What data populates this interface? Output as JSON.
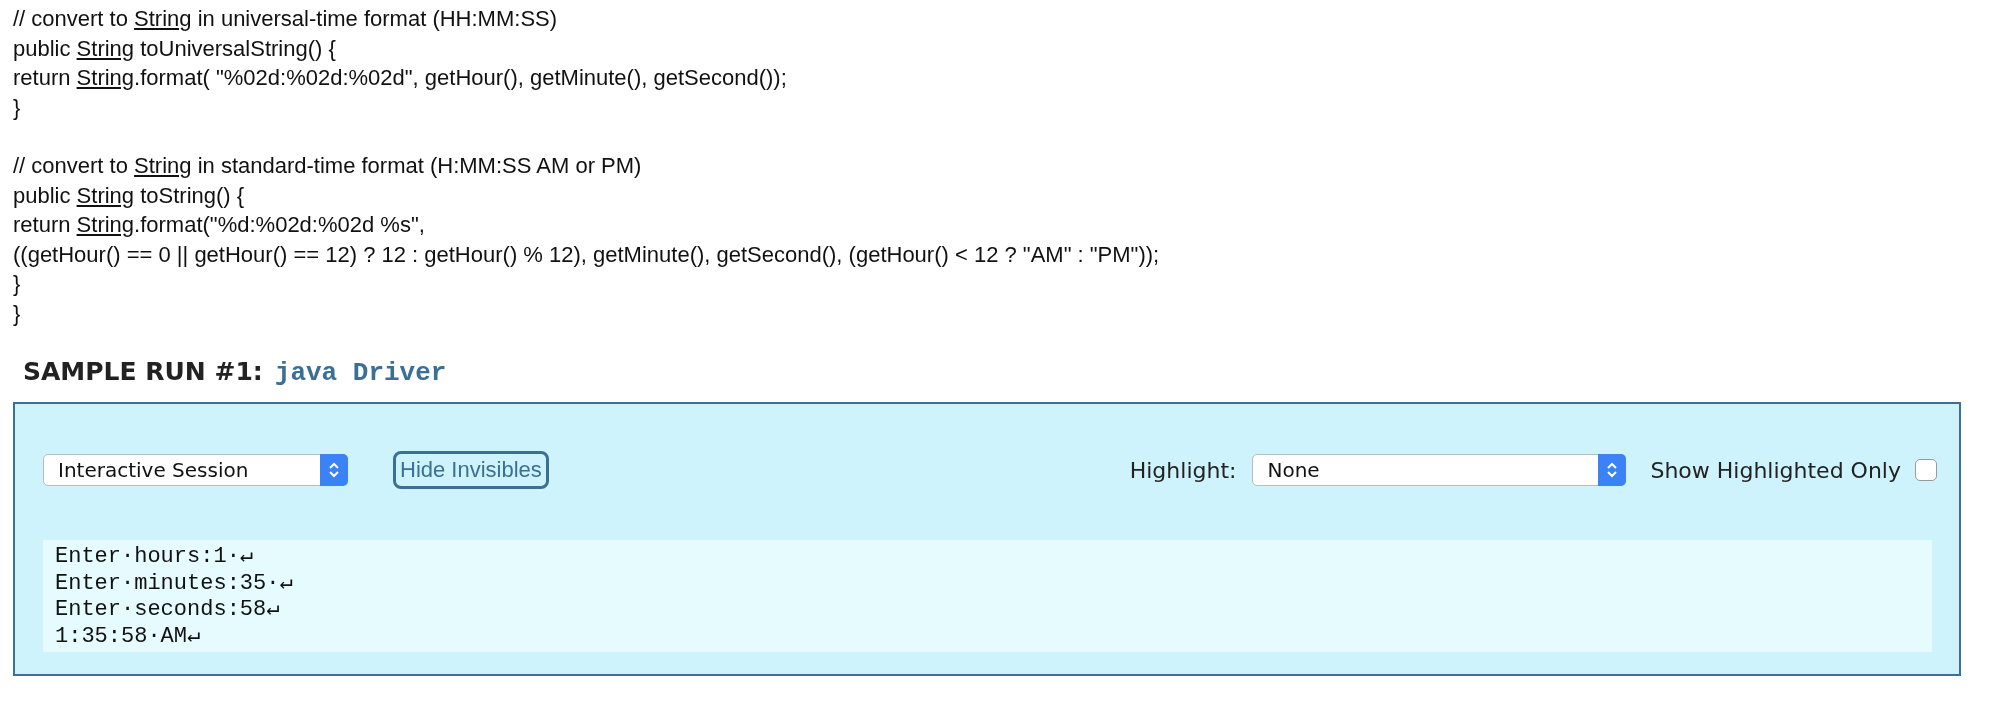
{
  "code_blocks": [
    {
      "lines": [
        {
          "kind": "linked",
          "segments": [
            {
              "text": "// convert to ",
              "link": false
            },
            {
              "text": "String",
              "link": true
            },
            {
              "text": " in universal-time format (HH:MM:SS)",
              "link": false
            }
          ]
        },
        {
          "kind": "linked",
          "segments": [
            {
              "text": "public ",
              "link": false
            },
            {
              "text": "String",
              "link": true
            },
            {
              "text": " toUniversalString() {",
              "link": false
            }
          ]
        },
        {
          "kind": "linked",
          "segments": [
            {
              "text": "return ",
              "link": false
            },
            {
              "text": "String",
              "link": true
            },
            {
              "text": ".format( \"%02d:%02d:%02d\", getHour(), getMinute(), getSecond());",
              "link": false
            }
          ]
        },
        {
          "kind": "plain",
          "text": "}"
        }
      ]
    },
    {
      "lines": [
        {
          "kind": "linked",
          "segments": [
            {
              "text": "// convert to ",
              "link": false
            },
            {
              "text": "String",
              "link": true
            },
            {
              "text": " in standard-time format (H:MM:SS AM or PM)",
              "link": false
            }
          ]
        },
        {
          "kind": "linked",
          "segments": [
            {
              "text": "public ",
              "link": false
            },
            {
              "text": "String",
              "link": true
            },
            {
              "text": " toString() {",
              "link": false
            }
          ]
        },
        {
          "kind": "linked",
          "segments": [
            {
              "text": "return ",
              "link": false
            },
            {
              "text": "String",
              "link": true
            },
            {
              "text": ".format(\"%d:%02d:%02d %s\",",
              "link": false
            }
          ]
        },
        {
          "kind": "plain",
          "text": "((getHour() == 0 || getHour() == 12) ? 12 : getHour() % 12), getMinute(), getSecond(), (getHour() < 12 ? \"AM\" : \"PM\"));"
        },
        {
          "kind": "plain",
          "text": "}"
        },
        {
          "kind": "plain",
          "text": "}"
        }
      ]
    }
  ],
  "sample_run": {
    "label": "SAMPLE RUN #1:",
    "command": "java Driver",
    "mode_select": {
      "value": "Interactive Session"
    },
    "toggle_button": {
      "label": "Hide Invisibles"
    },
    "highlight": {
      "label": "Highlight:",
      "value": "None"
    },
    "show_highlighted_only": {
      "label": "Show Highlighted Only",
      "checked": false
    },
    "output_lines": [
      "Enter·hours:1·↵",
      "Enter·minutes:35·↵",
      "Enter·seconds:58↵",
      "1:35:58·AM↵"
    ]
  }
}
